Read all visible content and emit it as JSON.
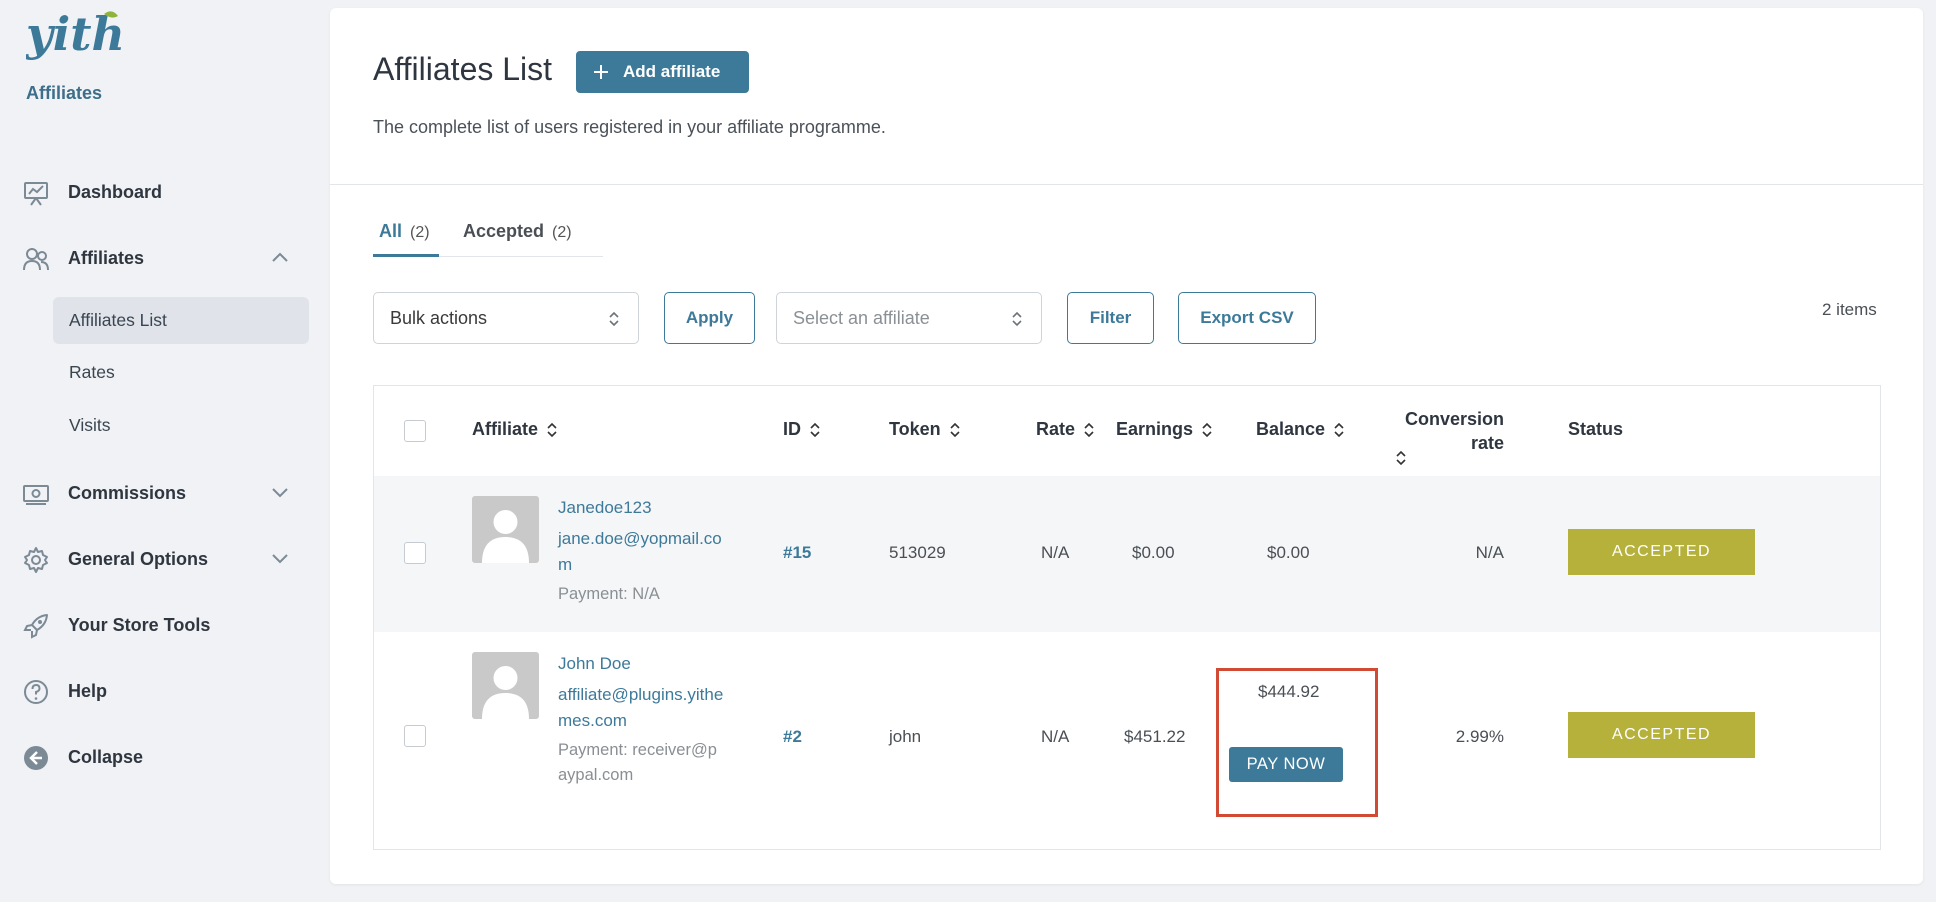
{
  "brand": {
    "logo_text": "yith",
    "section": "Affiliates"
  },
  "sidebar": {
    "items": [
      {
        "label": "Dashboard",
        "icon": "chart-presentation-icon"
      },
      {
        "label": "Affiliates",
        "icon": "users-icon",
        "expanded": true
      },
      {
        "label": "Commissions",
        "icon": "money-icon"
      },
      {
        "label": "General Options",
        "icon": "gear-icon"
      },
      {
        "label": "Your Store Tools",
        "icon": "rocket-icon"
      },
      {
        "label": "Help",
        "icon": "help-circle-icon"
      },
      {
        "label": "Collapse",
        "icon": "collapse-arrow-icon"
      }
    ],
    "subitems": [
      {
        "label": "Affiliates List",
        "active": true
      },
      {
        "label": "Rates"
      },
      {
        "label": "Visits"
      }
    ]
  },
  "header": {
    "title": "Affiliates List",
    "add_button": "Add affiliate",
    "description": "The complete list of users registered in your affiliate programme."
  },
  "tabs": [
    {
      "label": "All",
      "count": "(2)",
      "active": true
    },
    {
      "label": "Accepted",
      "count": "(2)"
    }
  ],
  "controls": {
    "bulk_actions": "Bulk actions",
    "apply": "Apply",
    "affiliate_placeholder": "Select an affiliate",
    "filter": "Filter",
    "export": "Export CSV",
    "items_count": "2 items"
  },
  "table": {
    "columns": {
      "affiliate": "Affiliate",
      "id": "ID",
      "token": "Token",
      "rate": "Rate",
      "earnings": "Earnings",
      "balance": "Balance",
      "conversion_line1": "Conversion",
      "conversion_line2": "rate",
      "status": "Status"
    },
    "rows": [
      {
        "name": "Janedoe123",
        "email": "jane.doe@yopmail.com",
        "payment": "Payment: N/A",
        "id": "#15",
        "token": "513029",
        "rate": "N/A",
        "earnings": "$0.00",
        "balance": "$0.00",
        "conversion": "N/A",
        "status": "ACCEPTED"
      },
      {
        "name": "John Doe",
        "email": "affiliate@plugins.yithemes.com",
        "payment": "Payment: receiver@paypal.com",
        "id": "#2",
        "token": "john",
        "rate": "N/A",
        "earnings": "$451.22",
        "balance": "$444.92",
        "pay_button": "PAY NOW",
        "conversion": "2.99%",
        "status": "ACCEPTED"
      }
    ]
  },
  "colors": {
    "accent": "#3d7a9a",
    "status_accepted": "#b5b13b",
    "highlight": "#d14a34"
  }
}
